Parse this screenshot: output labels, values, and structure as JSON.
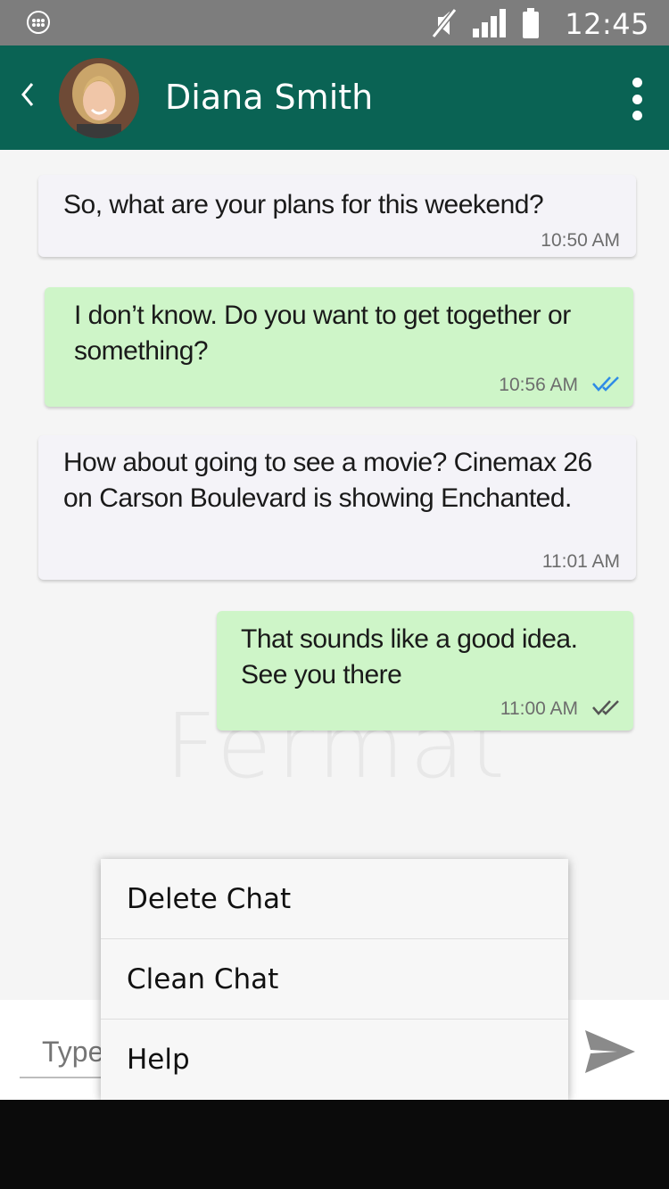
{
  "status_bar": {
    "time": "12:45",
    "icons": [
      "notification-icon",
      "mute-icon",
      "signal-icon",
      "battery-icon"
    ]
  },
  "header": {
    "contact_name": "Diana Smith",
    "back_icon": "back-arrow-icon",
    "menu_icon": "more-vert-icon"
  },
  "colors": {
    "appbar": "#0a6354",
    "incoming": "#f4f3f8",
    "outgoing": "#cef5c8",
    "read_tick": "#2e8be6",
    "status_bar": "#7d7d7d"
  },
  "watermark": "Fermat",
  "messages": [
    {
      "direction": "incoming",
      "text": "So, what are your plans for this weekend?",
      "time": "10:50 AM"
    },
    {
      "direction": "outgoing",
      "text": "I don’t know. Do you want to get together or something?",
      "time": "10:56 AM",
      "status": "read"
    },
    {
      "direction": "incoming",
      "text": "How about going to see a movie? Cinemax 26 on Carson Boulevard is showing Enchanted.",
      "time": "11:01 AM"
    },
    {
      "direction": "outgoing",
      "text": "That sounds like a good idea. See you there",
      "time": "11:00 AM",
      "status": "delivered"
    }
  ],
  "composer": {
    "placeholder": "Type",
    "send_icon": "send-icon"
  },
  "menu": {
    "items": [
      "Delete Chat",
      "Clean Chat",
      "Help"
    ]
  }
}
